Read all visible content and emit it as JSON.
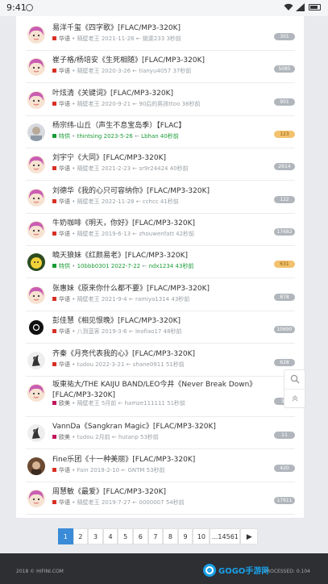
{
  "status": {
    "time": "9:41"
  },
  "threads": [
    {
      "title": "易洋千玺《四字歌》[FLAC/MP3-320K]",
      "forum": "华语",
      "author": "隔壁老王",
      "date": "2021-11-28",
      "replier": "姚雯233",
      "ago": "3秒前",
      "count": "301",
      "forum_color": "#d93025",
      "avatar": "girl"
    },
    {
      "title": "崔子格/杨培安《生死相随》[FLAC/MP3-320K]",
      "forum": "华语",
      "author": "隔壁老王",
      "date": "2020-3-26",
      "replier": "tianyu4057",
      "ago": "37秒前",
      "count": "5085",
      "forum_color": "#d93025",
      "avatar": "girl"
    },
    {
      "title": "叶炫清《关键词》[FLAC/MP3-320K]",
      "forum": "华语",
      "author": "隔壁老王",
      "date": "2020-9-21",
      "replier": "90后的男孩ttoo",
      "ago": "38秒前",
      "count": "901",
      "forum_color": "#d93025",
      "avatar": "girl"
    },
    {
      "title": "杨宗纬-山丘（声生不息宝岛季）【FLAC】",
      "forum": "特供",
      "author": "thintsing",
      "date": "2023-5-26",
      "replier": "Lbhan",
      "ago": "40秒前",
      "count": "123",
      "forum_color": "#1a9b35",
      "avatar": "photo",
      "hot": true,
      "green": true
    },
    {
      "title": "刘宇宁《大同》[FLAC/MP3-320K]",
      "forum": "华语",
      "author": "隔壁老王",
      "date": "2021-2-23",
      "replier": "sr9r24424",
      "ago": "40秒前",
      "count": "2614",
      "forum_color": "#d93025",
      "avatar": "girl"
    },
    {
      "title": "刘德华《我的心只可容纳你》[FLAC/MP3-320K]",
      "forum": "华语",
      "author": "隔壁老王",
      "date": "2022-11-28",
      "replier": "cchcc",
      "ago": "41秒前",
      "count": "122",
      "forum_color": "#d93025",
      "avatar": "girl"
    },
    {
      "title": "牛奶咖啡《明天，你好》[FLAC/MP3-320K]",
      "forum": "华语",
      "author": "隔壁老王",
      "date": "2019-6-13",
      "replier": "zhouwenfatt",
      "ago": "42秒前",
      "count": "17682",
      "forum_color": "#d93025",
      "avatar": "girl"
    },
    {
      "title": "曉天狼妹《红颜易老》[FLAC/MP3-320K]",
      "forum": "特供",
      "author": "10bbb0301",
      "date": "2022-7-22",
      "replier": "ndx1234",
      "ago": "43秒前",
      "count": "631",
      "forum_color": "#1a9b35",
      "avatar": "cartoon",
      "hot": true,
      "green": true
    },
    {
      "title": "张惠妹《原来你什么都不要》[FLAC/MP3-320K]",
      "forum": "华语",
      "author": "隔壁老王",
      "date": "2021-9-4",
      "replier": "ramiya1314",
      "ago": "43秒前",
      "count": "878",
      "forum_color": "#d93025",
      "avatar": "girl"
    },
    {
      "title": "彭佳慧《相见恨晚》[FLAC/MP3-320K]",
      "forum": "华语",
      "author": "八到蓝客",
      "date": "2019-3-6",
      "replier": "leofiao17",
      "ago": "48秒前",
      "count": "10690",
      "forum_color": "#d93025",
      "avatar": "dark"
    },
    {
      "title": "齐秦《月亮代表我的心》[FLAC/MP3-320K]",
      "forum": "华语",
      "author": "tudou",
      "date": "2022-3-21",
      "replier": "shane0911",
      "ago": "51秒前",
      "count": "628",
      "forum_color": "#d93025",
      "avatar": "ink"
    },
    {
      "title": "坂東祐大/THE KAIJU BAND/LEO今井《Never Break Down》[FLAC/MP3-320K]",
      "forum": "欧美",
      "author": "隔壁老王",
      "date": "5月前",
      "replier": "hamze111111",
      "ago": "51秒前",
      "count": "58",
      "forum_color": "#c2185b",
      "avatar": "girl",
      "wrap": true
    },
    {
      "title": "VannDa《Sangkran Magic》[FLAC/MP3-320K]",
      "forum": "欧美",
      "author": "tudou",
      "date": "2月前",
      "replier": "hutanp",
      "ago": "53秒前",
      "count": "11",
      "forum_color": "#c2185b",
      "avatar": "ink"
    },
    {
      "title": "Fine乐团《十一种美丽》[FLAC/MP3-320K]",
      "forum": "华语",
      "author": "Fain",
      "date": "2019-2-10",
      "replier": "GNTM",
      "ago": "53秒前",
      "count": "420",
      "forum_color": "#d93025",
      "avatar": "brown"
    },
    {
      "title": "周慧敏《最爱》[FLAC/MP3-320K]",
      "forum": "华语",
      "author": "隔壁老王",
      "date": "2019-7-27",
      "replier": "0000007",
      "ago": "54秒前",
      "count": "17611",
      "forum_color": "#d93025",
      "avatar": "girl"
    }
  ],
  "pager": {
    "pages": [
      "1",
      "2",
      "3",
      "4",
      "5",
      "6",
      "7",
      "8",
      "9",
      "10"
    ],
    "more": "...14561",
    "next": "▶"
  },
  "footer": {
    "left": "2018 © HIFINI.COM",
    "right": "PROCESSED: 0.104"
  },
  "logo": {
    "text": "GOGO手游网"
  },
  "colors": {
    "accent": "#3a8bd8",
    "badge": "#b0b6bc",
    "hot": "#f3c26f"
  }
}
